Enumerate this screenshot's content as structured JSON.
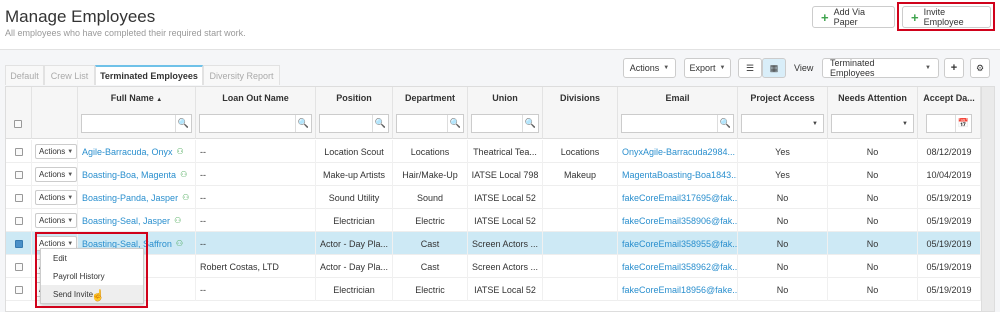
{
  "header": {
    "title": "Manage Employees",
    "subtitle": "All employees who have completed their required start work.",
    "add_via_paper": "Add Via Paper",
    "invite_employee": "Invite Employee"
  },
  "tabs": [
    "Default",
    "Crew List",
    "Terminated Employees",
    "Diversity Report"
  ],
  "toolbar": {
    "actions": "Actions",
    "export": "Export",
    "view_label": "View",
    "view_select": "Terminated Employees"
  },
  "columns": [
    "Full Name",
    "Loan Out Name",
    "Position",
    "Department",
    "Union",
    "Divisions",
    "Email",
    "Project Access",
    "Needs Attention",
    "Accept Da..."
  ],
  "row_action_label": "Actions",
  "rows": [
    {
      "name": "Agile-Barracuda, Onyx",
      "loanout": "--",
      "position": "Location Scout",
      "department": "Locations",
      "union": "Theatrical Tea...",
      "divisions": "Locations",
      "email": "OnyxAgile-Barracuda2984...",
      "access": "Yes",
      "attention": "No",
      "accept": "08/12/2019"
    },
    {
      "name": "Boasting-Boa, Magenta",
      "loanout": "--",
      "position": "Make-up Artists",
      "department": "Hair/Make-Up",
      "union": "IATSE Local 798",
      "divisions": "Makeup",
      "email": "MagentaBoasting-Boa1843...",
      "access": "Yes",
      "attention": "No",
      "accept": "10/04/2019"
    },
    {
      "name": "Boasting-Panda, Jasper",
      "loanout": "--",
      "position": "Sound Utility",
      "department": "Sound",
      "union": "IATSE Local 52",
      "divisions": "",
      "email": "fakeCoreEmail317695@fak...",
      "access": "No",
      "attention": "No",
      "accept": "05/19/2019"
    },
    {
      "name": "Boasting-Seal, Jasper",
      "loanout": "--",
      "position": "Electrician",
      "department": "Electric",
      "union": "IATSE Local 52",
      "divisions": "",
      "email": "fakeCoreEmail358906@fak...",
      "access": "No",
      "attention": "No",
      "accept": "05/19/2019"
    },
    {
      "name": "Boasting-Seal, Saffron",
      "loanout": "--",
      "position": "Actor - Day Pla...",
      "department": "Cast",
      "union": "Screen Actors ...",
      "divisions": "",
      "email": "fakeCoreEmail358955@fak...",
      "access": "No",
      "attention": "No",
      "accept": "05/19/2019"
    },
    {
      "name": "...eepy",
      "loanout": "Robert Costas, LTD",
      "position": "Actor - Day Pla...",
      "department": "Cast",
      "union": "Screen Actors ...",
      "divisions": "",
      "email": "fakeCoreEmail358962@fak...",
      "access": "No",
      "attention": "No",
      "accept": "05/19/2019"
    },
    {
      "name": "..., Opal",
      "loanout": "--",
      "position": "Electrician",
      "department": "Electric",
      "union": "IATSE Local 52",
      "divisions": "",
      "email": "fakeCoreEmail18956@fake...",
      "access": "No",
      "attention": "No",
      "accept": "05/19/2019"
    }
  ],
  "dropdown": [
    "Edit",
    "Payroll History",
    "Send Invite"
  ]
}
